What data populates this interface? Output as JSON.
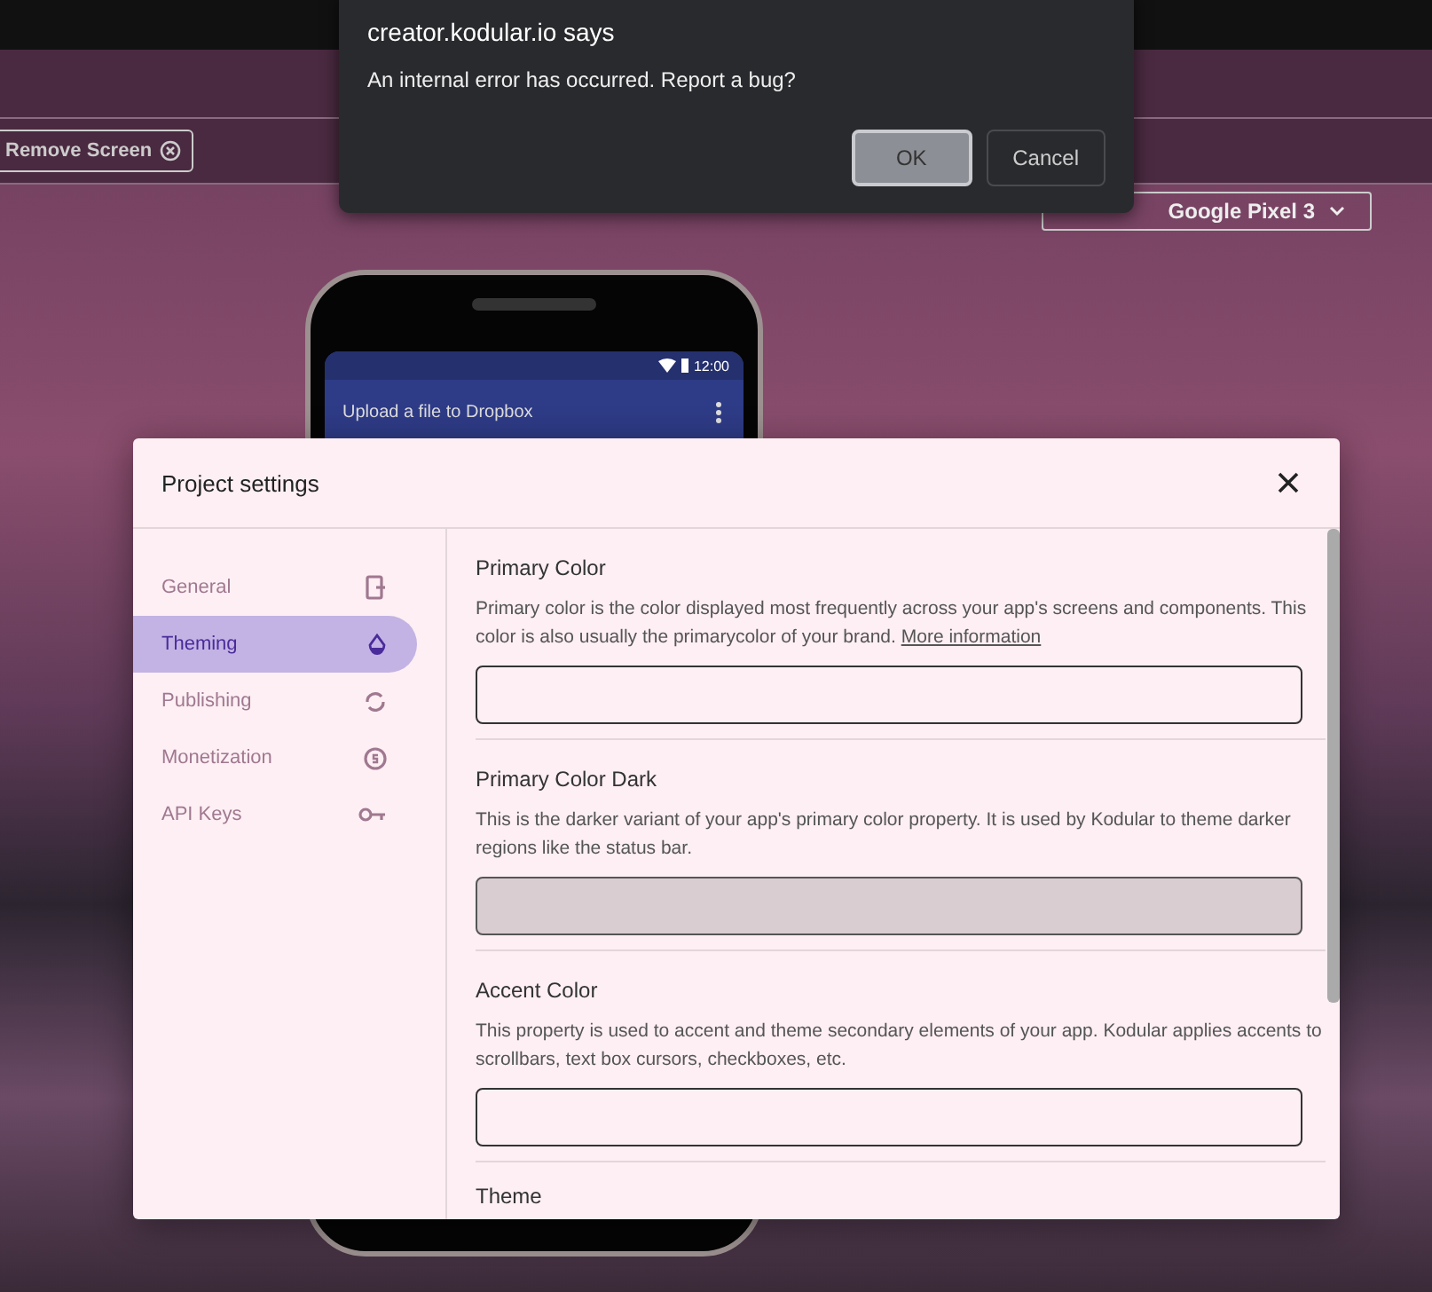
{
  "toolbar": {
    "remove_screen": "Remove Screen",
    "device": "Google Pixel 3"
  },
  "phone": {
    "time": "12:00",
    "app_title": "Upload a file to Dropbox"
  },
  "alert": {
    "title": "creator.kodular.io says",
    "message": "An internal error has occurred. Report a bug?",
    "buttons": [
      {
        "label": "OK",
        "kind": "primary"
      },
      {
        "label": "Cancel",
        "kind": "secondary"
      }
    ]
  },
  "modal": {
    "title": "Project settings",
    "sidebar": {
      "items": [
        {
          "label": "General",
          "selected": false
        },
        {
          "label": "Theming",
          "selected": true
        },
        {
          "label": "Publishing",
          "selected": false
        },
        {
          "label": "Monetization",
          "selected": false
        },
        {
          "label": "API Keys",
          "selected": false
        }
      ]
    },
    "sections": [
      {
        "title": "Primary Color",
        "description": "Primary color is the color displayed most frequently across your app's screens and components. This color is also usually the primarycolor of your brand.",
        "link": "More information",
        "disabled": false
      },
      {
        "title": "Primary Color Dark",
        "description": "This is the darker variant of your app's primary color property. It is used by Kodular to theme darker regions like the status bar.",
        "disabled": true
      },
      {
        "title": "Accent Color",
        "description": "This property is used to accent and theme secondary elements of your app. Kodular applies accents to scrollbars, text box cursors, checkboxes, etc.",
        "disabled": false
      },
      {
        "title": "Theme"
      }
    ]
  }
}
